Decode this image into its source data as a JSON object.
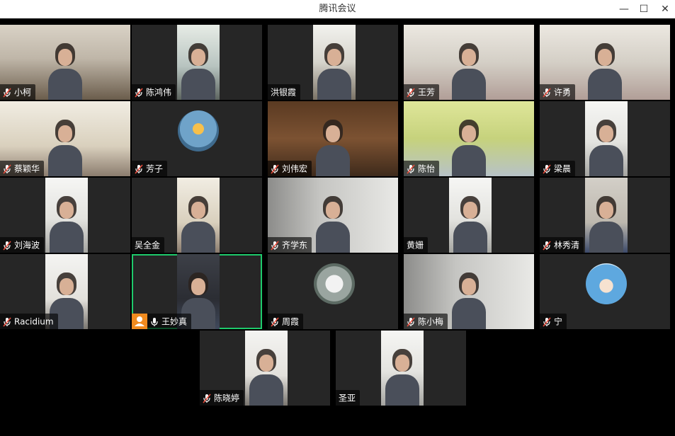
{
  "window": {
    "title": "腾讯会议",
    "controls": [
      {
        "name": "minimize-button",
        "glyph": "—"
      },
      {
        "name": "maximize-button",
        "glyph": "☐"
      },
      {
        "name": "close-button",
        "glyph": "✕"
      }
    ]
  },
  "colors": {
    "speaking_border": "#1ec96b",
    "host_badge": "#f08b1f",
    "tile_bg": "#262626"
  },
  "participants": [
    {
      "name": "小柯",
      "muted": true,
      "video": "office-shelf"
    },
    {
      "name": "陈鸿伟",
      "muted": true,
      "video": "room-light"
    },
    {
      "name": "洪银霞",
      "muted": false,
      "video": "office-window"
    },
    {
      "name": "王芳",
      "muted": true,
      "video": "home-curtain"
    },
    {
      "name": "许勇",
      "muted": true,
      "video": "home-curtain"
    },
    {
      "name": "蔡颖华",
      "muted": true,
      "video": "bright-room"
    },
    {
      "name": "芳子",
      "muted": true,
      "video": "avatar-parachute"
    },
    {
      "name": "刘伟宏",
      "muted": true,
      "video": "bookshelf"
    },
    {
      "name": "陈怡",
      "muted": true,
      "video": "green-wall"
    },
    {
      "name": "梁晨",
      "muted": true,
      "video": "white-room"
    },
    {
      "name": "刘海波",
      "muted": true,
      "video": "white-room"
    },
    {
      "name": "吴全金",
      "muted": false,
      "video": "bright-room"
    },
    {
      "name": "齐学东",
      "muted": true,
      "video": "curtain-gray"
    },
    {
      "name": "黄姗",
      "muted": false,
      "video": "white-room"
    },
    {
      "name": "林秀清",
      "muted": true,
      "video": "tile-wall"
    },
    {
      "name": "Racidium",
      "muted": true,
      "video": "ceiling"
    },
    {
      "name": "王妙真",
      "muted": false,
      "video": "dark-room",
      "speaking": true,
      "host": true
    },
    {
      "name": "周霞",
      "muted": true,
      "video": "avatar-landscape"
    },
    {
      "name": "陈小梅",
      "muted": true,
      "video": "curtain-gray"
    },
    {
      "name": "宁",
      "muted": true,
      "video": "avatar-girl"
    },
    {
      "name": "陈晓婷",
      "muted": true,
      "video": "ceiling"
    },
    {
      "name": "圣亚",
      "muted": false,
      "video": "white-room"
    }
  ]
}
